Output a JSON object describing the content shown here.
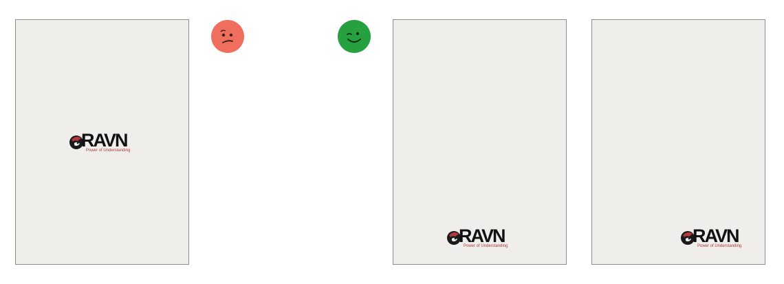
{
  "logo": {
    "name": "RAVN",
    "tagline": "Power of Understanding",
    "brand_text_color": "#111111",
    "tagline_color": "#b3373c"
  },
  "pages": [
    {
      "logo_position": "center"
    },
    {
      "logo_position": "bottom"
    },
    {
      "logo_position": "bottom"
    }
  ],
  "indicators": {
    "negative": {
      "icon": "confused-face-icon",
      "color": "#f06e5e"
    },
    "positive": {
      "icon": "winking-smile-icon",
      "color": "#27a13f"
    }
  },
  "page_color": "#efeeeb"
}
